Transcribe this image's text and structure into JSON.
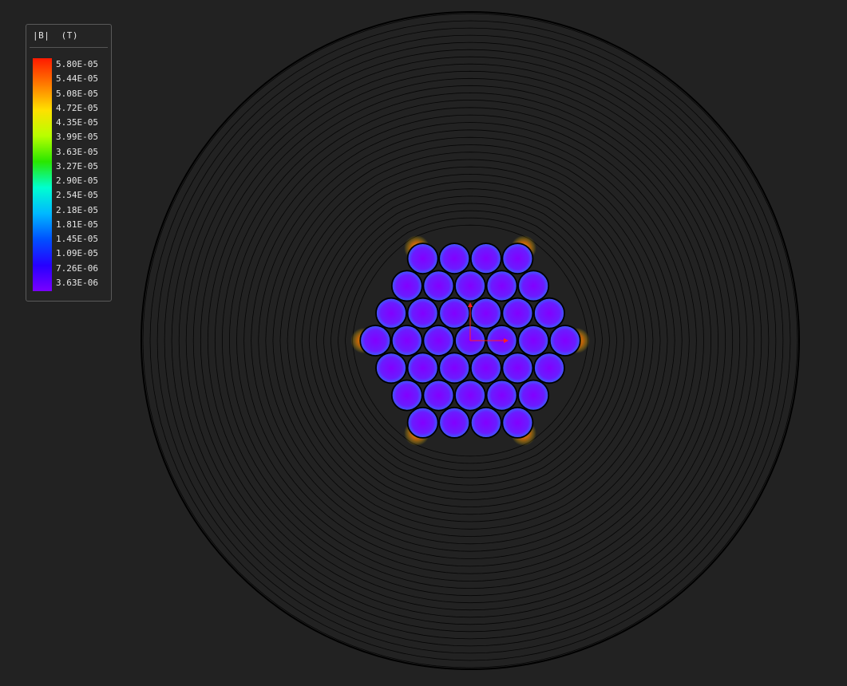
{
  "legend": {
    "title": "|B|  (T)",
    "ticks": [
      "5.80E-05",
      "5.44E-05",
      "5.08E-05",
      "4.72E-05",
      "4.35E-05",
      "3.99E-05",
      "3.63E-05",
      "3.27E-05",
      "2.90E-05",
      "2.54E-05",
      "2.18E-05",
      "1.81E-05",
      "1.45E-05",
      "1.09E-05",
      "7.26E-06",
      "3.63E-06"
    ],
    "colormap": [
      "#ff1a00",
      "#ff7a00",
      "#ffe000",
      "#b8ff00",
      "#29e600",
      "#00ffd0",
      "#00b8ff",
      "#0050ff",
      "#2600ff",
      "#7a00ff"
    ]
  },
  "scene": {
    "background": "#222222",
    "outline_color": "#000000",
    "axis_colors": {
      "x": "#ff2020",
      "y": "#ff2020"
    },
    "conductor_count": 37,
    "contour_count": 30
  }
}
